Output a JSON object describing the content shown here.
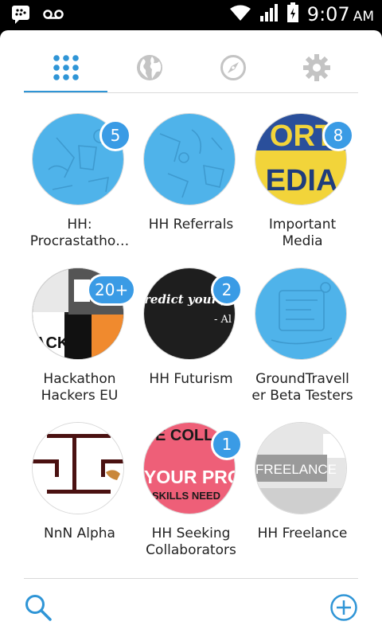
{
  "status_bar": {
    "time": "9:07",
    "ampm": "AM",
    "icons": [
      "bbm-icon",
      "voicemail-icon",
      "wifi-icon",
      "signal-icon",
      "battery-icon"
    ]
  },
  "tabs": [
    {
      "name": "grid",
      "icon": "grid-icon",
      "active": true
    },
    {
      "name": "globe",
      "icon": "globe-icon",
      "active": false
    },
    {
      "name": "compass",
      "icon": "compass-icon",
      "active": false
    },
    {
      "name": "settings",
      "icon": "gear-icon",
      "active": false
    }
  ],
  "groups": [
    {
      "line1": "HH:",
      "line2": "Procrastatho…",
      "badge": "5",
      "art": "blue-doodle"
    },
    {
      "line1": "HH Referrals",
      "line2": "",
      "badge": "",
      "art": "blue-doodle"
    },
    {
      "line1": "Important",
      "line2": "Media",
      "badge": "8",
      "art": "media-photo"
    },
    {
      "line1": "Hackathon",
      "line2": "Hackers EU",
      "badge": "20+",
      "art": "collage-photo"
    },
    {
      "line1": "HH Futurism",
      "line2": "",
      "badge": "2",
      "art": "futurism-photo"
    },
    {
      "line1": "GroundTravell",
      "line2": "er Beta Testers",
      "badge": "",
      "art": "blue-doodle"
    },
    {
      "line1": "NnN Alpha",
      "line2": "",
      "badge": "",
      "art": "alpha-logo"
    },
    {
      "line1": "HH Seeking",
      "line2": "Collaborators",
      "badge": "1",
      "art": "collaborators-photo"
    },
    {
      "line1": "HH Freelance",
      "line2": "",
      "badge": "",
      "art": "freelance-photo"
    }
  ],
  "photo_text": {
    "media": [
      "ORT",
      "EDIA"
    ],
    "futurism": [
      "redict your fut",
      "- Al"
    ],
    "collab": [
      "E COLL",
      "YOUR PRO",
      "SKILLS NEED"
    ],
    "freelance": "FREELANCE",
    "hack": "ACK"
  },
  "bottom_bar": {
    "left_icon": "search-icon",
    "right_icon": "add-icon"
  },
  "colors": {
    "accent": "#2f95d6",
    "badge": "#3a9be5",
    "doodle_blue": "#4fb3ea",
    "collab_pink": "#ee5f78"
  }
}
